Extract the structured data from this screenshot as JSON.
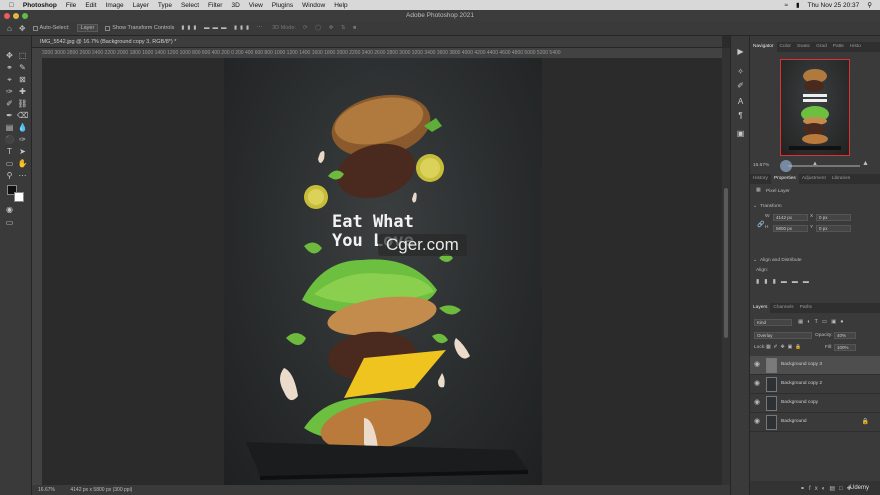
{
  "menubar": {
    "app": "Photoshop",
    "items": [
      "File",
      "Edit",
      "Image",
      "Layer",
      "Type",
      "Select",
      "Filter",
      "3D",
      "View",
      "Plugins",
      "Window",
      "Help"
    ],
    "clock": "Thu Nov 25  20:37"
  },
  "window_title": "Adobe Photoshop 2021",
  "options": {
    "auto_select_label": "Auto-Select:",
    "auto_select_value": "Layer",
    "transform_label": "Show Transform Controls",
    "mode_3d": "3D Mode:"
  },
  "document": {
    "tab_label": "IMG_5542.jpg @ 16.7% (Background copy 3, RGB/8*) *",
    "ruler_text": "3200 3000 2800 2600 2400 2200 2000 1800 1600 1400 1200 1000  800  600  400  200    0   200   400   600   800  1000  1200  1400  1600  1800  2000  2200  2400  2600  2800  3000  3200  3400  3600  3800  4000  4200  4400  4600  4800  5000  5200  5400",
    "poster_line1": "Eat What",
    "poster_line2": "You Love",
    "watermark": "Cger.com"
  },
  "status": {
    "zoom": "16.67%",
    "size": "4142 px x 5800 px (300 ppi)"
  },
  "panels": {
    "nav_tabs": [
      "Navigator",
      "Color",
      "Swatc",
      "Grad",
      "Patte",
      "Histo"
    ],
    "nav_zoom": "16.67%",
    "prop_tabs": [
      "History",
      "Properties",
      "Adjustment",
      "Libraries"
    ],
    "pixel_layer": "Pixel Layer",
    "transform": "Transform",
    "w": "W",
    "w_value": "4142 px",
    "h": "H",
    "h_value": "5800 px",
    "x": "X",
    "x_value": "0 px",
    "y": "Y",
    "y_value": "0 px",
    "align_label": "Align and Distribute",
    "align_sub": "Align:",
    "layer_tabs": [
      "Layers",
      "Channels",
      "Paths"
    ],
    "kind_label": "Kind",
    "blend": "Overlay",
    "opacity_label": "Opacity:",
    "opacity": "40%",
    "lock_label": "Lock:",
    "fill_label": "Fill:",
    "fill": "100%",
    "layers": [
      {
        "name": "Background copy 3"
      },
      {
        "name": "Background copy 2"
      },
      {
        "name": "Background copy"
      },
      {
        "name": "Background"
      }
    ],
    "udemy": "Udemy"
  }
}
